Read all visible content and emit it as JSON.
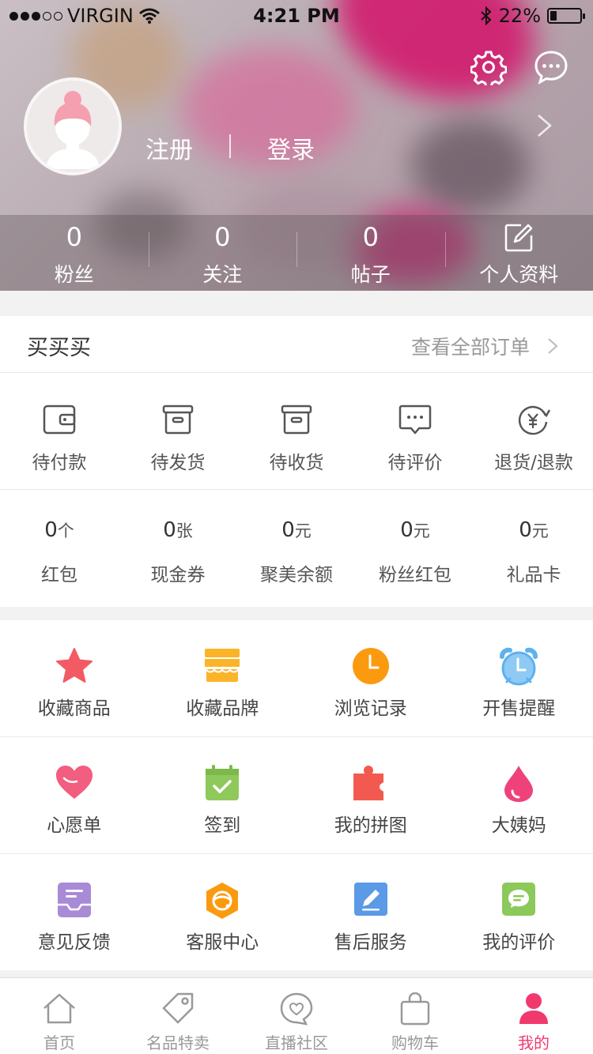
{
  "status_bar": {
    "carrier": "VIRGIN",
    "time": "4:21 PM",
    "battery": "22%",
    "battery_level": 0.22
  },
  "profile": {
    "register_label": "注册",
    "login_label": "登录",
    "stats": [
      {
        "value": "0",
        "label": "粉丝"
      },
      {
        "value": "0",
        "label": "关注"
      },
      {
        "value": "0",
        "label": "帖子"
      }
    ],
    "profile_label": "个人资料"
  },
  "orders": {
    "title": "买买买",
    "view_all": "查看全部订单",
    "items": [
      {
        "label": "待付款",
        "icon": "wallet-icon"
      },
      {
        "label": "待发货",
        "icon": "box-icon"
      },
      {
        "label": "待收货",
        "icon": "package-icon"
      },
      {
        "label": "待评价",
        "icon": "comment-icon"
      },
      {
        "label": "退货/退款",
        "icon": "refund-icon"
      }
    ]
  },
  "assets": [
    {
      "value": "0",
      "unit": "个",
      "label": "红包"
    },
    {
      "value": "0",
      "unit": "张",
      "label": "现金券"
    },
    {
      "value": "0",
      "unit": "元",
      "label": "聚美余额"
    },
    {
      "value": "0",
      "unit": "元",
      "label": "粉丝红包"
    },
    {
      "value": "0",
      "unit": "元",
      "label": "礼品卡"
    }
  ],
  "features": [
    {
      "label": "收藏商品",
      "icon": "star-icon",
      "color": "#f25a64"
    },
    {
      "label": "收藏品牌",
      "icon": "store-icon",
      "color": "#fbb428"
    },
    {
      "label": "浏览记录",
      "icon": "clock-icon",
      "color": "#fb9a0f"
    },
    {
      "label": "开售提醒",
      "icon": "alarm-icon",
      "color": "#5eb1ee"
    },
    {
      "label": "心愿单",
      "icon": "heart-icon",
      "color": "#f25e80"
    },
    {
      "label": "签到",
      "icon": "calendar-check-icon",
      "color": "#8fc95c"
    },
    {
      "label": "我的拼图",
      "icon": "puzzle-icon",
      "color": "#f25a50"
    },
    {
      "label": "大姨妈",
      "icon": "drop-icon",
      "color": "#f0427a"
    },
    {
      "label": "意见反馈",
      "icon": "feedback-icon",
      "color": "#a88ad6"
    },
    {
      "label": "客服中心",
      "icon": "service-icon",
      "color": "#fb9a0f"
    },
    {
      "label": "售后服务",
      "icon": "edit-icon",
      "color": "#5a9ae6"
    },
    {
      "label": "我的评价",
      "icon": "review-icon",
      "color": "#8bc95a"
    }
  ],
  "tabs": [
    {
      "label": "首页",
      "icon": "home-icon"
    },
    {
      "label": "名品特卖",
      "icon": "tag-icon"
    },
    {
      "label": "直播社区",
      "icon": "live-heart-icon"
    },
    {
      "label": "购物车",
      "icon": "bag-icon"
    },
    {
      "label": "我的",
      "icon": "person-icon"
    }
  ],
  "colors": {
    "accent": "#f03a6e",
    "text_muted": "#999999"
  }
}
